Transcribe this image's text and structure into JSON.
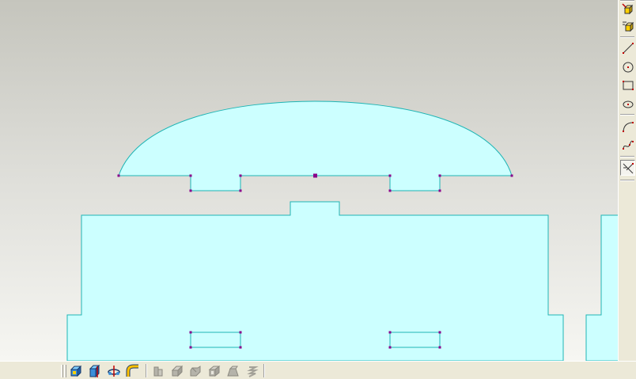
{
  "window": {
    "app": "sketcher",
    "colors": {
      "background_top": "#c8c8c0",
      "background_bottom": "#f4f4f0",
      "profile_fill": "#ccffff",
      "profile_edge": "#1fb5b5",
      "vertex": "#8a008a",
      "toolbar": "#ece9d8"
    }
  },
  "right_toolbar": {
    "tools": [
      {
        "name": "new-body-icon"
      },
      {
        "name": "body-mask-icon"
      },
      {
        "name": "line-icon"
      },
      {
        "name": "circle-icon"
      },
      {
        "name": "rectangle-icon"
      },
      {
        "name": "ellipse-icon"
      },
      {
        "name": "arc-icon"
      },
      {
        "name": "spline-icon"
      },
      {
        "name": "trim-icon",
        "pressed": true
      }
    ]
  },
  "bottom_toolbar": {
    "tools": [
      {
        "name": "extrude-icon",
        "enabled": true
      },
      {
        "name": "revolve-icon",
        "enabled": true
      },
      {
        "name": "rotate-body-icon",
        "enabled": true
      },
      {
        "name": "sweep-icon",
        "enabled": true
      },
      {
        "name": "boolean-icon",
        "enabled": false
      },
      {
        "name": "fillet-icon",
        "enabled": false
      },
      {
        "name": "chamfer-icon",
        "enabled": false
      },
      {
        "name": "shell-icon",
        "enabled": false
      },
      {
        "name": "draft-icon",
        "enabled": false
      },
      {
        "name": "thread-icon",
        "enabled": false
      }
    ]
  }
}
